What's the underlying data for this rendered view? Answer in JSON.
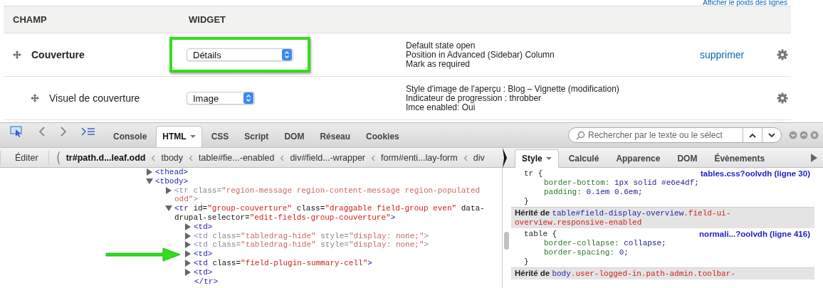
{
  "top_link": "Afficher le poids des lignes",
  "table": {
    "columns": [
      "CHAMP",
      "WIDGET"
    ],
    "rows": [
      {
        "label": "Couverture",
        "widget": {
          "value": "Détails",
          "highlighted": true
        },
        "summary": [
          "Default state open",
          "Position in Advanced (Sidebar) Column",
          "Mark as required"
        ],
        "action": "supprimer",
        "children": [
          {
            "label": "Visuel de couverture",
            "widget": {
              "value": "Image",
              "highlighted": false
            },
            "summary": [
              "Style d'image de l'aperçu : Blog – Vignette (modification)",
              "Indicateur de progression : throbber",
              "Imce enabled: Oui"
            ]
          }
        ]
      }
    ]
  },
  "devtools": {
    "tabs": [
      {
        "label": "Console",
        "selected": false
      },
      {
        "label": "HTML",
        "selected": true,
        "menu": true
      },
      {
        "label": "CSS",
        "selected": false
      },
      {
        "label": "Script",
        "selected": false
      },
      {
        "label": "DOM",
        "selected": false
      },
      {
        "label": "Réseau",
        "selected": false
      },
      {
        "label": "Cookies",
        "selected": false
      }
    ],
    "search": {
      "placeholder": "Rechercher par le texte ou le sélect"
    },
    "edit_button": "Éditer",
    "breadcrumb": [
      {
        "label": "tr#path.d...leaf.odd",
        "selected": true
      },
      {
        "label": "tbody",
        "selected": false
      },
      {
        "label": "table#fie...-enabled",
        "selected": false
      },
      {
        "label": "div#field...-wrapper",
        "selected": false
      },
      {
        "label": "form#enti...lay-form",
        "selected": false
      },
      {
        "label": "div",
        "selected": false
      }
    ],
    "side_tabs": [
      {
        "label": "Style",
        "selected": true,
        "menu": true
      },
      {
        "label": "Calculé",
        "selected": false
      },
      {
        "label": "Apparence",
        "selected": false
      },
      {
        "label": "DOM",
        "selected": false
      },
      {
        "label": "Évènements",
        "selected": false
      }
    ],
    "html_tree": [
      {
        "kind": "element",
        "expanded": false,
        "dimmed": false,
        "parts": [
          {
            "kind": "tag",
            "text": "<thead>"
          }
        ]
      },
      {
        "kind": "element",
        "expanded": true,
        "dimmed": false,
        "parts": [
          {
            "kind": "tag",
            "text": "<tbody>"
          }
        ],
        "children": [
          {
            "kind": "element",
            "expanded": false,
            "dimmed": true,
            "parts": [
              {
                "kind": "tag",
                "text": "<tr"
              },
              {
                "kind": "attr",
                "text": " class="
              },
              {
                "kind": "value",
                "text": "\"region-message region-content-message region-populated odd\""
              },
              {
                "kind": "tag",
                "text": ">"
              }
            ]
          },
          {
            "kind": "element",
            "expanded": true,
            "dimmed": false,
            "parts": [
              {
                "kind": "tag",
                "text": "<tr"
              },
              {
                "kind": "attr",
                "text": " id="
              },
              {
                "kind": "value",
                "text": "\"group-couverture\""
              },
              {
                "kind": "attr",
                "text": " class="
              },
              {
                "kind": "value",
                "text": "\"draggable field-group even\""
              },
              {
                "kind": "attr",
                "text": " data-drupal-selector="
              },
              {
                "kind": "value",
                "text": "\"edit-fields-group-couverture\""
              },
              {
                "kind": "tag",
                "text": ">"
              }
            ],
            "children": [
              {
                "kind": "element",
                "expanded": false,
                "dimmed": false,
                "parts": [
                  {
                    "kind": "tag",
                    "text": "<td>"
                  }
                ]
              },
              {
                "kind": "element",
                "expanded": false,
                "dimmed": true,
                "parts": [
                  {
                    "kind": "tag",
                    "text": "<td"
                  },
                  {
                    "kind": "attr",
                    "text": " class="
                  },
                  {
                    "kind": "value",
                    "text": "\"tabledrag-hide\""
                  },
                  {
                    "kind": "attr",
                    "text": " style="
                  },
                  {
                    "kind": "value",
                    "text": "\"display: none;\""
                  },
                  {
                    "kind": "tag",
                    "text": ">"
                  }
                ]
              },
              {
                "kind": "element",
                "expanded": false,
                "dimmed": true,
                "parts": [
                  {
                    "kind": "tag",
                    "text": "<td"
                  },
                  {
                    "kind": "attr",
                    "text": " class="
                  },
                  {
                    "kind": "value",
                    "text": "\"tabledrag-hide\""
                  },
                  {
                    "kind": "attr",
                    "text": " style="
                  },
                  {
                    "kind": "value",
                    "text": "\"display: none;\""
                  },
                  {
                    "kind": "tag",
                    "text": ">"
                  }
                ]
              },
              {
                "kind": "element",
                "expanded": false,
                "dimmed": false,
                "pointed": true,
                "parts": [
                  {
                    "kind": "tag",
                    "text": "<td>"
                  }
                ]
              },
              {
                "kind": "element",
                "expanded": false,
                "dimmed": false,
                "parts": [
                  {
                    "kind": "tag",
                    "text": "<td"
                  },
                  {
                    "kind": "attr",
                    "text": " class="
                  },
                  {
                    "kind": "value",
                    "text": "\"field-plugin-summary-cell\""
                  },
                  {
                    "kind": "tag",
                    "text": ">"
                  }
                ]
              },
              {
                "kind": "element",
                "expanded": false,
                "dimmed": false,
                "parts": [
                  {
                    "kind": "tag",
                    "text": "<td>"
                  }
                ]
              },
              {
                "kind": "close",
                "parts": [
                  {
                    "kind": "tag",
                    "text": "</tr>"
                  }
                ]
              }
            ]
          }
        ]
      }
    ],
    "style_rules": [
      {
        "kind": "rule",
        "selector": "tr {",
        "source": "tables.css?oolvdh (ligne 30)",
        "declarations": [
          [
            "border-bottom:",
            "1px solid #e6e4df;"
          ],
          [
            "padding:",
            "0.1em 0.6em;"
          ]
        ],
        "close": "}"
      },
      {
        "kind": "inherited",
        "label": "Hérité de",
        "parts": [
          {
            "kind": "id",
            "text": "table#field-display-overview"
          },
          {
            "kind": "class",
            "text": ".field-ui-overview.responsive-enabled"
          }
        ]
      },
      {
        "kind": "rule",
        "selector": "table {",
        "source": "normali...?oolvdh (ligne 416)",
        "declarations": [
          [
            "border-collapse:",
            "collapse;"
          ],
          [
            "border-spacing:",
            "0;"
          ]
        ],
        "close": "}"
      },
      {
        "kind": "inherited",
        "label": "Hérité de",
        "parts": [
          {
            "kind": "id",
            "text": "body"
          },
          {
            "kind": "class",
            "text": ".user-logged-in.path-admin.toolbar-"
          }
        ]
      }
    ]
  }
}
